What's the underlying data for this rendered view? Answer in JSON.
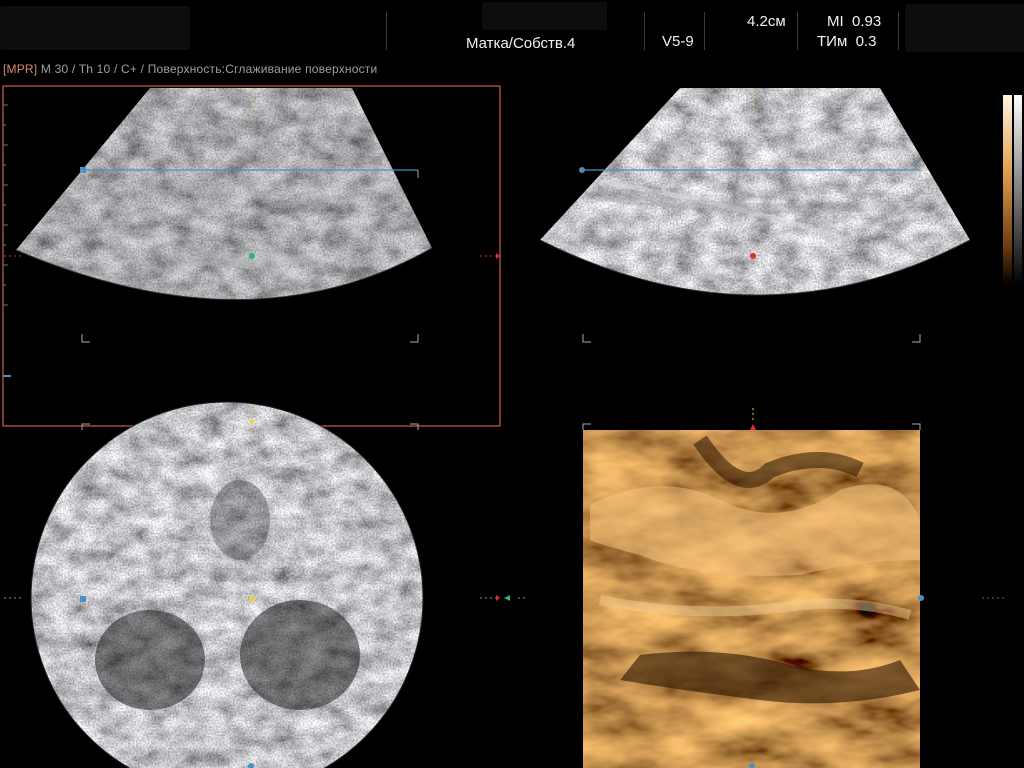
{
  "header": {
    "preset": "Матка/Собств.4",
    "probe": "V5-9",
    "depth": "4.2см",
    "mi": "MI  0.93",
    "ti": "ТИм  0.3"
  },
  "mpr_bar": {
    "tag": "[MPR]",
    "text": " M 30 / Th 10 / C+ / Поверхность:Сглаживание поверхности"
  },
  "panes": {
    "a": "plane-a",
    "b": "plane-b",
    "c": "plane-c",
    "render": "3d-render"
  },
  "colors": {
    "active_frame": "#c8604a",
    "cursor_line": "#4a8fc4",
    "marker_green": "#2bb673",
    "marker_red": "#e0302a",
    "marker_yellow": "#e8d24a",
    "render_tint": "#c97a2a"
  }
}
